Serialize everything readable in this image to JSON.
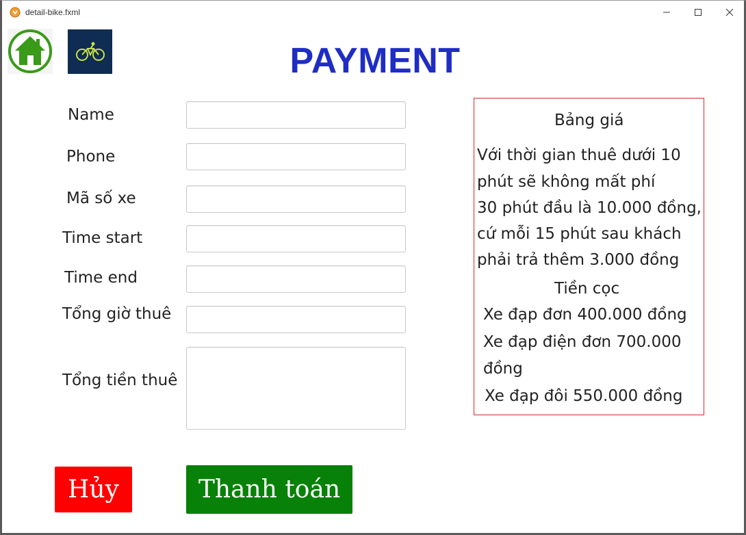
{
  "window": {
    "title": "detail-bike.fxml"
  },
  "header": {
    "title": "PAYMENT",
    "home_icon": "home-icon",
    "logo_icon": "bicycle-logo"
  },
  "form": {
    "name_label": "Name",
    "phone_label": "Phone",
    "bike_code_label": "Mã số xe",
    "time_start_label": "Time start",
    "time_end_label": "Time end",
    "total_hours_label": "Tổng giờ thuê",
    "total_cost_label": "Tổng tiền thuê",
    "name_value": "",
    "phone_value": "",
    "bike_code_value": "",
    "time_start_value": "",
    "time_end_value": "",
    "total_hours_value": "",
    "total_cost_value": ""
  },
  "price_table": {
    "title": "Bảng giá",
    "rule_lines": [
      "Với thời gian thuê dưới 10",
      "phút sẽ không mất phí",
      "30 phút đầu là 10.000 đồng,",
      "cứ mỗi 15 phút sau khách",
      "phải trả thêm 3.000 đồng"
    ],
    "deposit_title": "Tiền cọc",
    "deposit_lines": [
      "Xe đạp đơn 400.000 đồng",
      "Xe đạp điện đơn 700.000",
      "đồng",
      "Xe đạp đôi 550.000 đồng"
    ]
  },
  "actions": {
    "cancel_label": "Hủy",
    "pay_label": "Thanh toán"
  },
  "colors": {
    "title": "#1f2dc4",
    "cancel_button": "#ff0000",
    "pay_button": "#078107",
    "price_border": "#d42a2a",
    "logo_background": "#0f2c52",
    "home_icon": "#3a9a1a"
  }
}
